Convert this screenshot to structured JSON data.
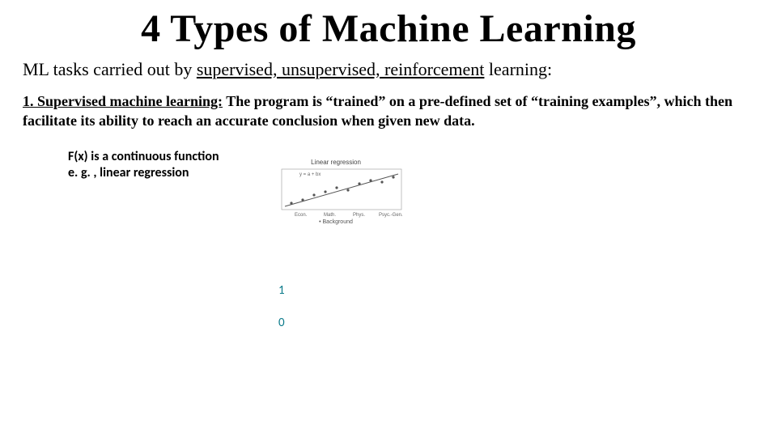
{
  "title": "4 Types of Machine Learning",
  "subtitle_prefix": "ML tasks carried out by ",
  "subtitle_underlined": "supervised, unsupervised, reinforcement",
  "subtitle_suffix": "  learning:",
  "sections": [
    {
      "heading": "1. Supervised machine learning:",
      "body": " The program is “trained” on a pre-defined set of “training examples”, which then facilitate its ability to reach an accurate conclusion when given new data."
    }
  ],
  "fx": {
    "line1": "F(x) is a continuous function",
    "line2": "e. g. , linear regression"
  },
  "digits": {
    "top": "1",
    "bottom": "0"
  },
  "chart_data": {
    "type": "scatter",
    "title": "Linear regression",
    "xlabel": "Background",
    "ylabel": "",
    "x": [
      1,
      2,
      3,
      4,
      5,
      6,
      7,
      8,
      9,
      10
    ],
    "y": [
      1.2,
      1.7,
      2.4,
      2.9,
      3.5,
      3.2,
      4.1,
      4.6,
      4.3,
      5.0
    ],
    "trend": {
      "x1": 0.5,
      "y1": 1.0,
      "x2": 10.5,
      "y2": 5.2
    },
    "xlim": [
      0,
      11
    ],
    "ylim": [
      0,
      6
    ],
    "xticks": [
      "Econ.",
      "Math.",
      "Phys.",
      "Psyc.-Gen."
    ]
  }
}
